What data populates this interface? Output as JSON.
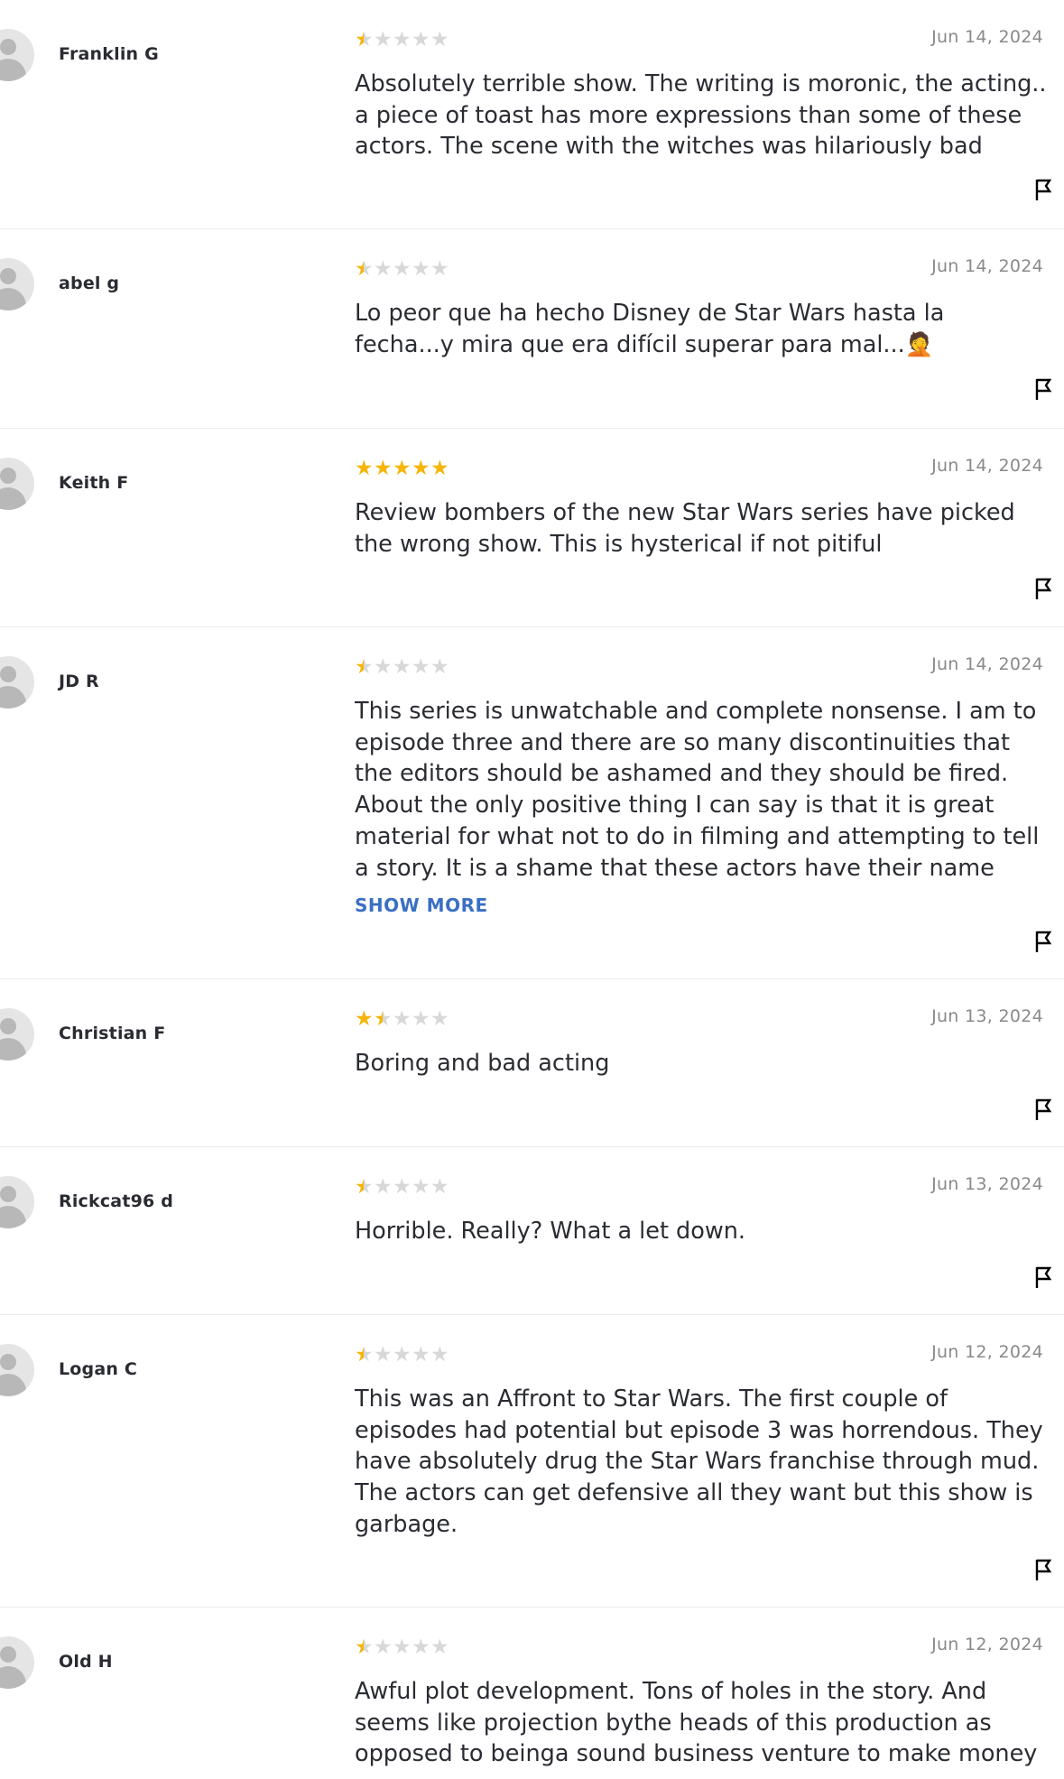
{
  "reviews": [
    {
      "name": "Franklin G",
      "rating": 0.5,
      "date": "Jun 14, 2024",
      "text": "Absolutely terrible show. The writing is moronic, the acting.. a piece of toast has more expressions than some of these actors. The scene with the witches was hilariously bad"
    },
    {
      "name": "abel g",
      "rating": 0.5,
      "date": "Jun 14, 2024",
      "text": "Lo peor que ha hecho Disney de Star Wars hasta la fecha...y mira que era difícil superar para mal...🤦"
    },
    {
      "name": "Keith F",
      "rating": 5,
      "date": "Jun 14, 2024",
      "text": "Review bombers of the new Star Wars series have picked the wrong show. This is hysterical if not pitiful"
    },
    {
      "name": "JD R",
      "rating": 0.5,
      "date": "Jun 14, 2024",
      "text": "This series is unwatchable and complete nonsense. I am to episode three and there are so many discontinuities that the editors should be ashamed and they should be fired. About the only positive thing I can say is that it is great material for what not to do in filming and attempting to tell a story. It is a shame that these actors have their name associated with...",
      "show_more": "SHOW MORE"
    },
    {
      "name": "Christian F",
      "rating": 1.5,
      "date": "Jun 13, 2024",
      "text": "Boring and bad acting"
    },
    {
      "name": "Rickcat96 d",
      "rating": 0.5,
      "date": "Jun 13, 2024",
      "text": "Horrible. Really? What a let down."
    },
    {
      "name": "Logan C",
      "rating": 0.5,
      "date": "Jun 12, 2024",
      "text": "This was an Affront to Star Wars. The first couple of episodes had potential but episode 3 was horrendous. They have absolutely drug the Star Wars franchise through mud. The actors can get defensive all they want but this show is garbage."
    },
    {
      "name": "Old H",
      "rating": 0.5,
      "date": "Jun 12, 2024",
      "text": "Awful plot development. Tons of holes in the story. And seems like projection bythe heads of this production as opposed to beinga sound business venture to make money"
    }
  ],
  "icons": {
    "avatar": "user-placeholder-icon",
    "flag": "flag-icon",
    "star": "star-icon"
  },
  "colors": {
    "star_filled": "#f5b50a",
    "star_empty": "#d8d8d8",
    "link": "#3a6fc3"
  }
}
